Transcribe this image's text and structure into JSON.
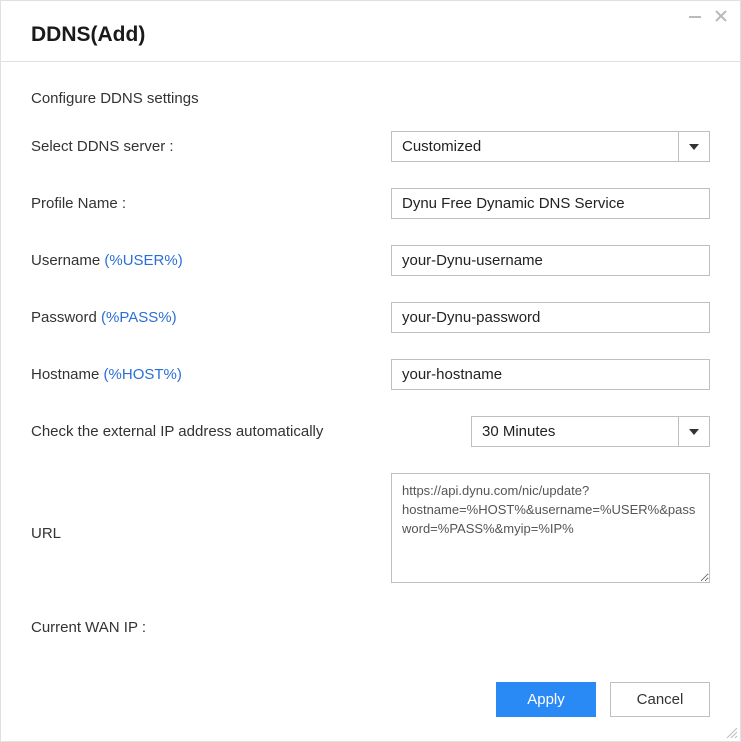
{
  "window": {
    "title": "DDNS(Add)"
  },
  "section": {
    "title": "Configure DDNS settings"
  },
  "labels": {
    "select_server": "Select DDNS server :",
    "profile_name": "Profile Name :",
    "username_prefix": "Username ",
    "username_token": "(%USER%)",
    "password_prefix": "Password ",
    "password_token": "(%PASS%)",
    "hostname_prefix": "Hostname ",
    "hostname_token": "(%HOST%)",
    "check_ip": "Check the external IP address automatically",
    "url": "URL",
    "current_wan_ip": "Current WAN IP :"
  },
  "values": {
    "select_server": "Customized",
    "profile_name": "Dynu Free Dynamic DNS Service",
    "username": "your-Dynu-username",
    "password": "your-Dynu-password",
    "hostname": "your-hostname",
    "check_ip_interval": "30 Minutes",
    "url": "https://api.dynu.com/nic/update?hostname=%HOST%&username=%USER%&password=%PASS%&myip=%IP%",
    "current_wan_ip": ""
  },
  "buttons": {
    "apply": "Apply",
    "cancel": "Cancel"
  }
}
